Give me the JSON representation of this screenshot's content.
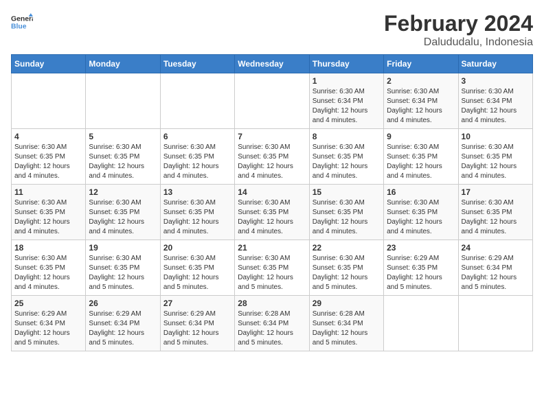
{
  "logo": {
    "text_general": "General",
    "text_blue": "Blue"
  },
  "header": {
    "title": "February 2024",
    "subtitle": "Dalududalu, Indonesia"
  },
  "weekdays": [
    "Sunday",
    "Monday",
    "Tuesday",
    "Wednesday",
    "Thursday",
    "Friday",
    "Saturday"
  ],
  "weeks": [
    [
      {
        "day": "",
        "info": ""
      },
      {
        "day": "",
        "info": ""
      },
      {
        "day": "",
        "info": ""
      },
      {
        "day": "",
        "info": ""
      },
      {
        "day": "1",
        "info": "Sunrise: 6:30 AM\nSunset: 6:34 PM\nDaylight: 12 hours and 4 minutes."
      },
      {
        "day": "2",
        "info": "Sunrise: 6:30 AM\nSunset: 6:34 PM\nDaylight: 12 hours and 4 minutes."
      },
      {
        "day": "3",
        "info": "Sunrise: 6:30 AM\nSunset: 6:34 PM\nDaylight: 12 hours and 4 minutes."
      }
    ],
    [
      {
        "day": "4",
        "info": "Sunrise: 6:30 AM\nSunset: 6:35 PM\nDaylight: 12 hours and 4 minutes."
      },
      {
        "day": "5",
        "info": "Sunrise: 6:30 AM\nSunset: 6:35 PM\nDaylight: 12 hours and 4 minutes."
      },
      {
        "day": "6",
        "info": "Sunrise: 6:30 AM\nSunset: 6:35 PM\nDaylight: 12 hours and 4 minutes."
      },
      {
        "day": "7",
        "info": "Sunrise: 6:30 AM\nSunset: 6:35 PM\nDaylight: 12 hours and 4 minutes."
      },
      {
        "day": "8",
        "info": "Sunrise: 6:30 AM\nSunset: 6:35 PM\nDaylight: 12 hours and 4 minutes."
      },
      {
        "day": "9",
        "info": "Sunrise: 6:30 AM\nSunset: 6:35 PM\nDaylight: 12 hours and 4 minutes."
      },
      {
        "day": "10",
        "info": "Sunrise: 6:30 AM\nSunset: 6:35 PM\nDaylight: 12 hours and 4 minutes."
      }
    ],
    [
      {
        "day": "11",
        "info": "Sunrise: 6:30 AM\nSunset: 6:35 PM\nDaylight: 12 hours and 4 minutes."
      },
      {
        "day": "12",
        "info": "Sunrise: 6:30 AM\nSunset: 6:35 PM\nDaylight: 12 hours and 4 minutes."
      },
      {
        "day": "13",
        "info": "Sunrise: 6:30 AM\nSunset: 6:35 PM\nDaylight: 12 hours and 4 minutes."
      },
      {
        "day": "14",
        "info": "Sunrise: 6:30 AM\nSunset: 6:35 PM\nDaylight: 12 hours and 4 minutes."
      },
      {
        "day": "15",
        "info": "Sunrise: 6:30 AM\nSunset: 6:35 PM\nDaylight: 12 hours and 4 minutes."
      },
      {
        "day": "16",
        "info": "Sunrise: 6:30 AM\nSunset: 6:35 PM\nDaylight: 12 hours and 4 minutes."
      },
      {
        "day": "17",
        "info": "Sunrise: 6:30 AM\nSunset: 6:35 PM\nDaylight: 12 hours and 4 minutes."
      }
    ],
    [
      {
        "day": "18",
        "info": "Sunrise: 6:30 AM\nSunset: 6:35 PM\nDaylight: 12 hours and 4 minutes."
      },
      {
        "day": "19",
        "info": "Sunrise: 6:30 AM\nSunset: 6:35 PM\nDaylight: 12 hours and 5 minutes."
      },
      {
        "day": "20",
        "info": "Sunrise: 6:30 AM\nSunset: 6:35 PM\nDaylight: 12 hours and 5 minutes."
      },
      {
        "day": "21",
        "info": "Sunrise: 6:30 AM\nSunset: 6:35 PM\nDaylight: 12 hours and 5 minutes."
      },
      {
        "day": "22",
        "info": "Sunrise: 6:30 AM\nSunset: 6:35 PM\nDaylight: 12 hours and 5 minutes."
      },
      {
        "day": "23",
        "info": "Sunrise: 6:29 AM\nSunset: 6:35 PM\nDaylight: 12 hours and 5 minutes."
      },
      {
        "day": "24",
        "info": "Sunrise: 6:29 AM\nSunset: 6:34 PM\nDaylight: 12 hours and 5 minutes."
      }
    ],
    [
      {
        "day": "25",
        "info": "Sunrise: 6:29 AM\nSunset: 6:34 PM\nDaylight: 12 hours and 5 minutes."
      },
      {
        "day": "26",
        "info": "Sunrise: 6:29 AM\nSunset: 6:34 PM\nDaylight: 12 hours and 5 minutes."
      },
      {
        "day": "27",
        "info": "Sunrise: 6:29 AM\nSunset: 6:34 PM\nDaylight: 12 hours and 5 minutes."
      },
      {
        "day": "28",
        "info": "Sunrise: 6:28 AM\nSunset: 6:34 PM\nDaylight: 12 hours and 5 minutes."
      },
      {
        "day": "29",
        "info": "Sunrise: 6:28 AM\nSunset: 6:34 PM\nDaylight: 12 hours and 5 minutes."
      },
      {
        "day": "",
        "info": ""
      },
      {
        "day": "",
        "info": ""
      }
    ]
  ]
}
